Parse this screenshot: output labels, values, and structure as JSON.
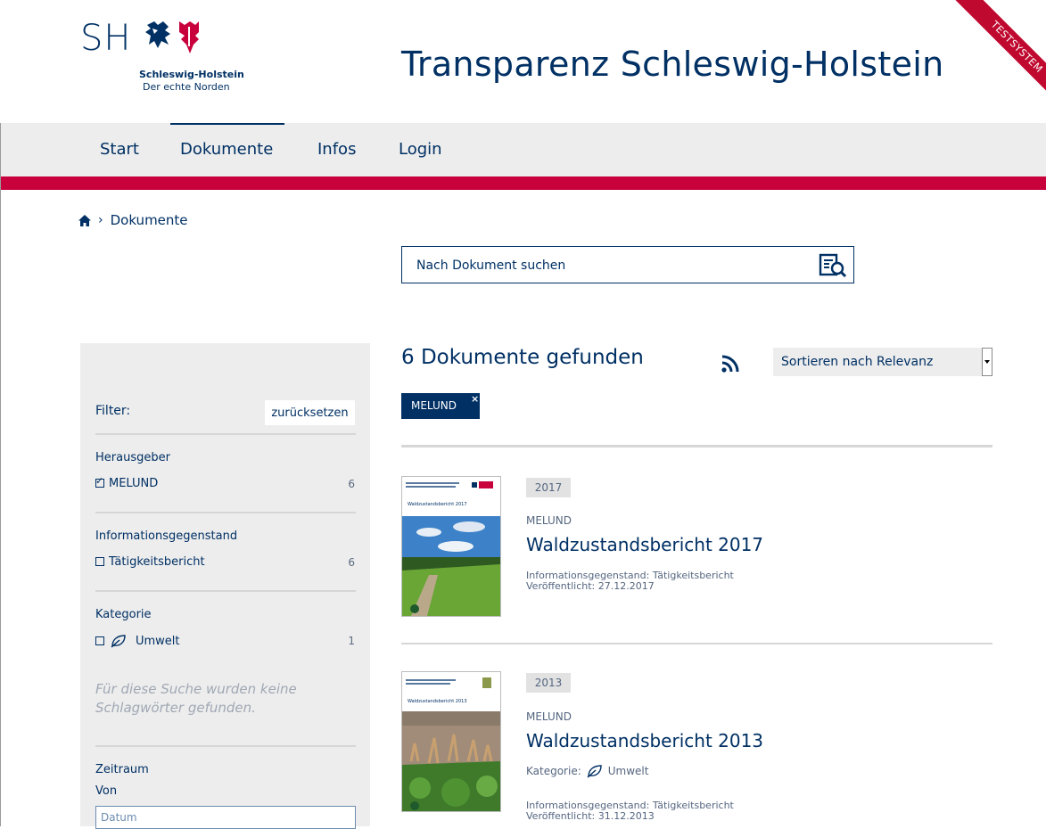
{
  "header": {
    "logo_sh": "SH",
    "logo_line1": "Schleswig-Holstein",
    "logo_line2": "Der echte Norden",
    "site_title": "Transparenz Schleswig-Holstein",
    "ribbon": "TESTSYSTEM"
  },
  "nav": {
    "items": [
      {
        "label": "Start"
      },
      {
        "label": "Dokumente",
        "active": true
      },
      {
        "label": "Infos"
      },
      {
        "label": "Login"
      }
    ]
  },
  "breadcrumb": {
    "current": "Dokumente"
  },
  "search": {
    "placeholder": "Nach Dokument suchen"
  },
  "sidebar": {
    "filter_label": "Filter:",
    "reset_label": "zurücksetzen",
    "groups": [
      {
        "title": "Herausgeber",
        "option": "MELUND",
        "checked": true,
        "count": "6"
      },
      {
        "title": "Informationsgegenstand",
        "option": "Tätigkeitsbericht",
        "checked": false,
        "count": "6"
      },
      {
        "title": "Kategorie",
        "option": "Umwelt",
        "checked": false,
        "count": "1",
        "icon": "leaf-icon"
      }
    ],
    "no_keywords": "Für diese Suche wurden keine Schlagwörter gefunden.",
    "period_title": "Zeitraum",
    "from_label": "Von",
    "date_placeholder": "Datum"
  },
  "results": {
    "count_text": "6 Dokumente gefunden",
    "sort_label": "Sortieren nach Relevanz",
    "active_tag": "MELUND",
    "tag_remove": "×",
    "items": [
      {
        "year": "2017",
        "publisher": "MELUND",
        "title": "Waldzustandsbericht 2017",
        "subject": "Informationsgegenstand: Tätigkeitsbericht",
        "published": "Veröffentlicht: 27.12.2017",
        "cover_title": "Waldzustandsbericht 2017"
      },
      {
        "year": "2013",
        "publisher": "MELUND",
        "title": "Waldzustandsbericht 2013",
        "category_label": "Kategorie:",
        "category": "Umwelt",
        "subject": "Informationsgegenstand: Tätigkeitsbericht",
        "published": "Veröffentlicht: 31.12.2013",
        "cover_title": "Waldzustandsbericht 2013"
      }
    ]
  },
  "colors": {
    "navy": "#003064",
    "red": "#c8003c",
    "nav_bg": "#ededed"
  }
}
